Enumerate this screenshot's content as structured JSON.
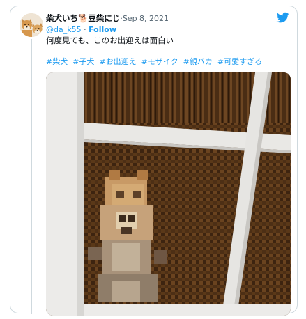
{
  "tweet": {
    "display_name": "柴犬いち🐕豆柴にじ",
    "date_separator": " · ",
    "date": "Sep 8, 2021",
    "handle": "@da_k55",
    "follow_separator": " · ",
    "follow_label": "Follow",
    "text": "何度見ても、このお出迎えは面白い",
    "hashtags": [
      "#柴犬",
      "#子犬",
      "#お出迎え",
      "#モザイク",
      "#親バカ",
      "#可愛すぎる"
    ]
  },
  "icons": {
    "brand": "twitter-bird-icon",
    "avatar": "shiba-dogs-avatar"
  },
  "colors": {
    "link": "#1d9bf0",
    "text": "#0f1419",
    "muted": "#536471",
    "border": "#cfd9de",
    "door_frame": "#e8e8e6",
    "glass_wood": "#4a2c12"
  }
}
